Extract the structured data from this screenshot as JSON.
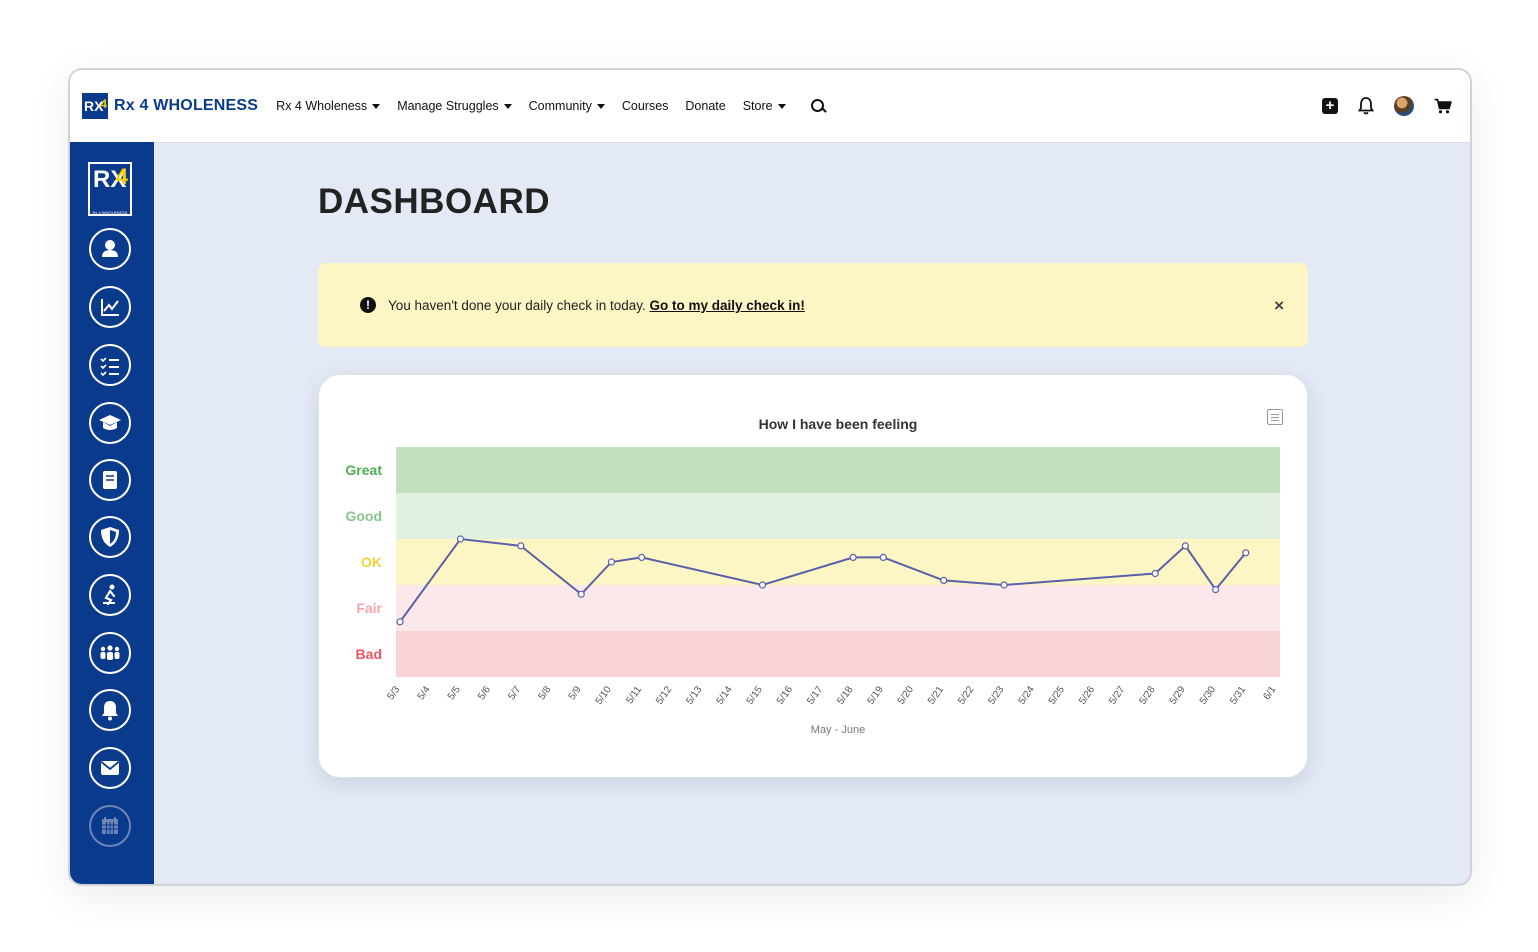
{
  "brand": {
    "logo_text": "RX",
    "logo_num": "4",
    "name": "Rx 4 WHOLENESS",
    "side_sub": "Rx 4 WHOLENESS"
  },
  "nav": {
    "items": [
      {
        "label": "Rx 4 Wholeness",
        "dropdown": true
      },
      {
        "label": "Manage Struggles",
        "dropdown": true
      },
      {
        "label": "Community",
        "dropdown": true
      },
      {
        "label": "Courses",
        "dropdown": false
      },
      {
        "label": "Donate",
        "dropdown": false
      },
      {
        "label": "Store",
        "dropdown": true
      }
    ],
    "right_icons": [
      "plus-square-icon",
      "bell-icon",
      "avatar",
      "cart-icon"
    ]
  },
  "sidebar": {
    "icons": [
      "user-icon",
      "chart-line-icon",
      "checklist-icon",
      "graduation-cap-icon",
      "book-icon",
      "shield-icon",
      "prayer-icon",
      "group-icon",
      "bell-icon",
      "envelope-icon",
      "calendar-icon"
    ]
  },
  "page": {
    "title": "DASHBOARD"
  },
  "alert": {
    "text": "You haven't done your daily check in today.",
    "link": "Go to my daily check in!",
    "close": "×"
  },
  "chart_data": {
    "type": "line",
    "title": "How I have been feeling",
    "xlabel": "May - June",
    "bands": [
      {
        "label": "Great",
        "color": "#c1e1c1",
        "text_color": "#4caf50"
      },
      {
        "label": "Good",
        "color": "#e1f0e1",
        "text_color": "#8ac48a"
      },
      {
        "label": "OK",
        "color": "#fcf6c5",
        "text_color": "#f0d43a"
      },
      {
        "label": "Fair",
        "color": "#fbe8ea",
        "text_color": "#f4a6ad"
      },
      {
        "label": "Bad",
        "color": "#f9d4d6",
        "text_color": "#e85560"
      }
    ],
    "ylim": [
      1,
      6
    ],
    "categories": [
      "5/3",
      "5/4",
      "5/5",
      "5/6",
      "5/7",
      "5/8",
      "5/9",
      "5/10",
      "5/11",
      "5/12",
      "5/13",
      "5/14",
      "5/15",
      "5/16",
      "5/17",
      "5/18",
      "5/19",
      "5/20",
      "5/21",
      "5/22",
      "5/23",
      "5/24",
      "5/25",
      "5/26",
      "5/27",
      "5/28",
      "5/29",
      "5/30",
      "5/31",
      "6/1"
    ],
    "series": [
      {
        "color": "#5b5fa8",
        "points": [
          {
            "x": "5/3",
            "y": 2.2
          },
          {
            "x": "5/5",
            "y": 4.0
          },
          {
            "x": "5/7",
            "y": 3.85
          },
          {
            "x": "5/9",
            "y": 2.8
          },
          {
            "x": "5/10",
            "y": 3.5
          },
          {
            "x": "5/11",
            "y": 3.6
          },
          {
            "x": "5/15",
            "y": 3.0
          },
          {
            "x": "5/18",
            "y": 3.6
          },
          {
            "x": "5/19",
            "y": 3.6
          },
          {
            "x": "5/21",
            "y": 3.1
          },
          {
            "x": "5/23",
            "y": 3.0
          },
          {
            "x": "5/28",
            "y": 3.25
          },
          {
            "x": "5/29",
            "y": 3.85
          },
          {
            "x": "5/30",
            "y": 2.9
          },
          {
            "x": "5/31",
            "y": 3.7
          }
        ]
      }
    ]
  }
}
